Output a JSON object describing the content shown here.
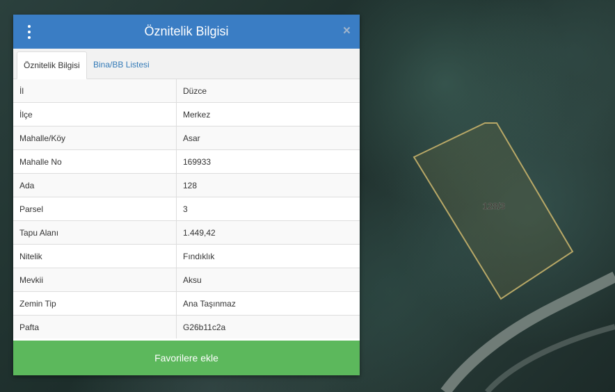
{
  "panel": {
    "title": "Öznitelik Bilgisi",
    "close_symbol": "×",
    "menu_icon": "vertical-dots-icon"
  },
  "tabs": [
    {
      "label": "Öznitelik Bilgisi",
      "active": true
    },
    {
      "label": "Bina/BB Listesi",
      "active": false
    }
  ],
  "attributes": [
    {
      "key": "İl",
      "value": "Düzce"
    },
    {
      "key": "İlçe",
      "value": "Merkez"
    },
    {
      "key": "Mahalle/Köy",
      "value": "Asar"
    },
    {
      "key": "Mahalle No",
      "value": "169933"
    },
    {
      "key": "Ada",
      "value": "128"
    },
    {
      "key": "Parsel",
      "value": "3"
    },
    {
      "key": "Tapu Alanı",
      "value": "1.449,42"
    },
    {
      "key": "Nitelik",
      "value": "Fındıklık"
    },
    {
      "key": "Mevkii",
      "value": "Aksu"
    },
    {
      "key": "Zemin Tip",
      "value": "Ana Taşınmaz"
    },
    {
      "key": "Pafta",
      "value": "G26b11c2a"
    }
  ],
  "favorite_button": {
    "label": "Favorilere ekle"
  },
  "map": {
    "parcel_label": "128/3",
    "parcel_outline_color": "#b8a867"
  },
  "colors": {
    "header": "#3a7dc4",
    "button": "#5cb85c",
    "link": "#337ab7"
  }
}
